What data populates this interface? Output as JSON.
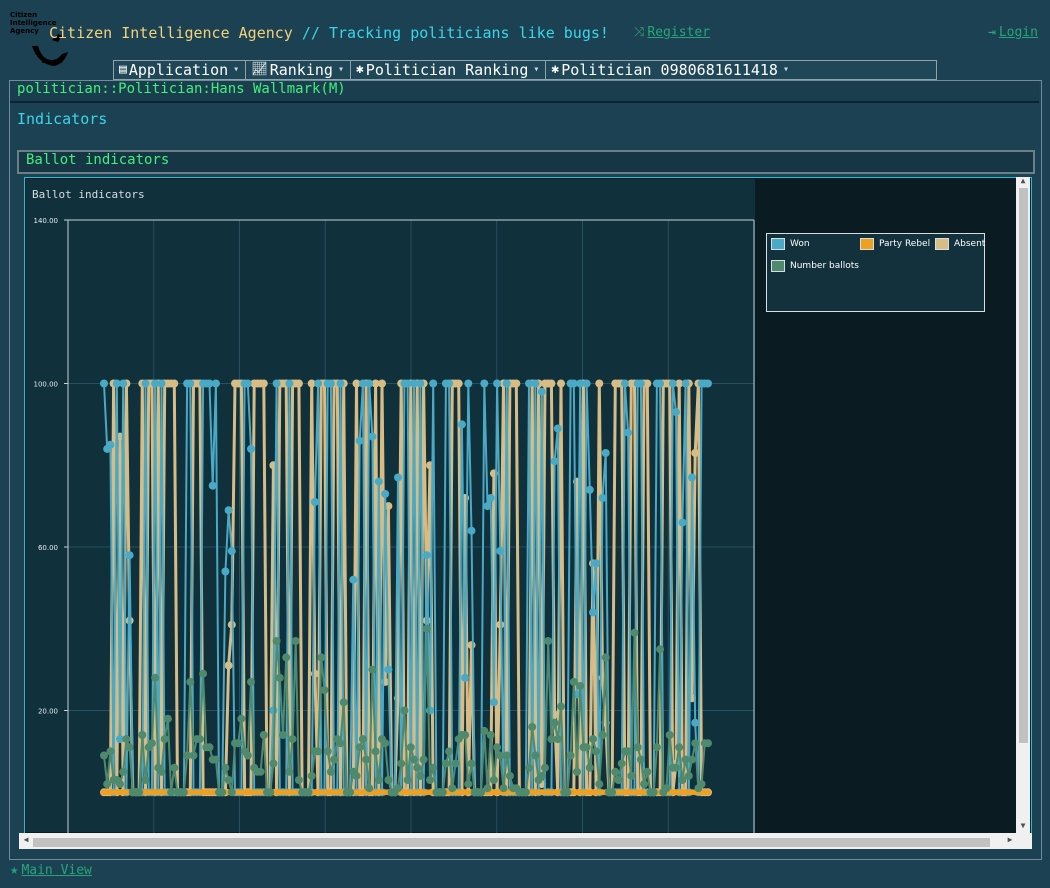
{
  "header": {
    "logo_text": "Citizen Intelligence Agency",
    "title": "Citizen Intelligence Agency",
    "slogan": "// Tracking politicians like bugs!",
    "register_label": "Register",
    "login_label": "Login",
    "register_icon": "shuffle-icon",
    "login_icon": "sign-in-icon"
  },
  "menu": [
    {
      "label": "Application",
      "icon": "server-icon"
    },
    {
      "label": "Ranking",
      "icon": "line-chart-icon"
    },
    {
      "label": "Politician Ranking",
      "icon": "bug-icon"
    },
    {
      "label": "Politician 0980681611418",
      "icon": "bug-icon"
    }
  ],
  "breadcrumb": "politician::Politician:Hans Wallmark(M)",
  "page_heading": "Indicators",
  "section_title": "Ballot indicators",
  "footer_link": "Main View",
  "colors": {
    "won": "#4aa9c4",
    "party_rebel": "#f0a020",
    "absent": "#d8bc85",
    "number_ballots": "#4f8a6e"
  },
  "chart_data": {
    "type": "line",
    "title": "Ballot indicators",
    "y_ticks": [
      "140.00",
      "100.00",
      "60.00",
      "20.00"
    ],
    "ylim": [
      -30,
      140
    ],
    "legend_position": "top-right (outside plot)",
    "series": [
      {
        "name": "Won",
        "color": "#4aa9c4",
        "range": [
          0,
          100
        ]
      },
      {
        "name": "Party Rebel",
        "color": "#f0a020",
        "range": [
          0,
          0
        ]
      },
      {
        "name": "Absent",
        "color": "#d8bc85",
        "range": [
          0,
          100
        ]
      },
      {
        "name": "Number ballots",
        "color": "#4f8a6e",
        "range": [
          0,
          40
        ]
      }
    ]
  }
}
